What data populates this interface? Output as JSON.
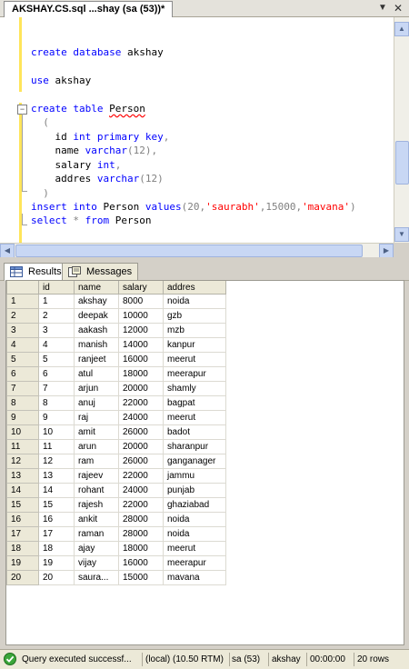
{
  "window": {
    "tab_title": "AKSHAY.CS.sql ...shay (sa (53))*"
  },
  "editor": {
    "lines": [
      {
        "parts": [
          [
            "kw",
            "create database "
          ],
          [
            "txt",
            "akshay"
          ]
        ]
      },
      {
        "parts": [
          [
            "kw",
            "use "
          ],
          [
            "txt",
            "akshay"
          ]
        ]
      },
      {
        "parts": [
          [
            "kw",
            "create table "
          ],
          [
            "sq",
            "Person"
          ]
        ]
      },
      {
        "parts": [
          [
            "gray",
            "  ("
          ]
        ]
      },
      {
        "parts": [
          [
            "txt",
            "    id "
          ],
          [
            "kw",
            "int primary key"
          ],
          [
            "gray",
            ","
          ]
        ]
      },
      {
        "parts": [
          [
            "txt",
            "    name "
          ],
          [
            "kw",
            "varchar"
          ],
          [
            "gray",
            "(12),"
          ]
        ]
      },
      {
        "parts": [
          [
            "txt",
            "    salary "
          ],
          [
            "kw",
            "int"
          ],
          [
            "gray",
            ","
          ]
        ]
      },
      {
        "parts": [
          [
            "txt",
            "    addres "
          ],
          [
            "kw",
            "varchar"
          ],
          [
            "gray",
            "(12)"
          ]
        ]
      },
      {
        "parts": [
          [
            "gray",
            "  )"
          ]
        ]
      },
      {
        "parts": [
          [
            "kw",
            "insert into "
          ],
          [
            "txt",
            "Person "
          ],
          [
            "kw",
            "values"
          ],
          [
            "gray",
            "(20,"
          ],
          [
            "str",
            "'saurabh'"
          ],
          [
            "gray",
            ",15000,"
          ],
          [
            "str",
            "'mavana'"
          ],
          [
            "gray",
            ")"
          ]
        ]
      },
      {
        "parts": [
          [
            "kw",
            "select "
          ],
          [
            "gray",
            "* "
          ],
          [
            "kw",
            "from "
          ],
          [
            "txt",
            "Person"
          ]
        ]
      }
    ]
  },
  "results_tabs": [
    {
      "label": "Results",
      "icon": "grid-icon",
      "active": true
    },
    {
      "label": "Messages",
      "icon": "messages-icon",
      "active": false
    }
  ],
  "grid": {
    "columns": [
      "id",
      "name",
      "salary",
      "addres"
    ],
    "rows": [
      [
        "1",
        "1",
        "akshay",
        "8000",
        "noida"
      ],
      [
        "2",
        "2",
        "deepak",
        "10000",
        "gzb"
      ],
      [
        "3",
        "3",
        "aakash",
        "12000",
        "mzb"
      ],
      [
        "4",
        "4",
        "manish",
        "14000",
        "kanpur"
      ],
      [
        "5",
        "5",
        "ranjeet",
        "16000",
        "meerut"
      ],
      [
        "6",
        "6",
        "atul",
        "18000",
        "meerapur"
      ],
      [
        "7",
        "7",
        "arjun",
        "20000",
        "shamly"
      ],
      [
        "8",
        "8",
        "anuj",
        "22000",
        "bagpat"
      ],
      [
        "9",
        "9",
        "raj",
        "24000",
        "meerut"
      ],
      [
        "10",
        "10",
        "amit",
        "26000",
        "badot"
      ],
      [
        "11",
        "11",
        "arun",
        "20000",
        "sharanpur"
      ],
      [
        "12",
        "12",
        "ram",
        "26000",
        "ganganager"
      ],
      [
        "13",
        "13",
        "rajeev",
        "22000",
        "jammu"
      ],
      [
        "14",
        "14",
        "rohant",
        "24000",
        "punjab"
      ],
      [
        "15",
        "15",
        "rajesh",
        "22000",
        "ghaziabad"
      ],
      [
        "16",
        "16",
        "ankit",
        "28000",
        "noida"
      ],
      [
        "17",
        "17",
        "raman",
        "28000",
        "noida"
      ],
      [
        "18",
        "18",
        "ajay",
        "18000",
        "meerut"
      ],
      [
        "19",
        "19",
        "vijay",
        "16000",
        "meerapur"
      ],
      [
        "20",
        "20",
        "saura...",
        "15000",
        "mavana"
      ]
    ]
  },
  "status": {
    "message": "Query executed successf...",
    "server": "(local) (10.50 RTM)",
    "login": "sa (53)",
    "database": "akshay",
    "elapsed": "00:00:00",
    "rows": "20 rows"
  }
}
